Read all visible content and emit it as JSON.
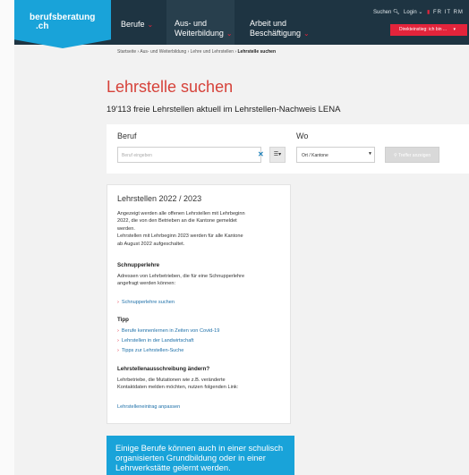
{
  "header": {
    "logo": {
      "line1": "berufsberatung",
      "line2": ".ch"
    },
    "nav": [
      {
        "line1": "Berufe",
        "line2": ""
      },
      {
        "line1": "Aus- und",
        "line2": "Weiterbildung"
      },
      {
        "line1": "Arbeit und",
        "line2": "Beschäftigung"
      }
    ],
    "utility": {
      "search": "Suchen",
      "login": "Login",
      "lang_fr": "FR",
      "lang_it": "IT",
      "lang_rm": "RM"
    },
    "cta": "Direkteinstieg: ich bin ..."
  },
  "breadcrumb": {
    "items": [
      "Startseite",
      "Aus- und Weiterbildung",
      "Lehre und Lehrstellen"
    ],
    "current": "Lehrstelle suchen",
    "separator": "›"
  },
  "page": {
    "title": "Lehrstelle suchen",
    "subtitle": "19'113 freie Lehrstellen aktuell im Lehrstellen-Nachweis LENA"
  },
  "search": {
    "beruf_label": "Beruf",
    "beruf_placeholder": "Beruf eingeben",
    "wo_label": "Wo",
    "ort_value": "Ort / Kantone",
    "results_button": "Treffer anzeigen"
  },
  "info": {
    "title": "Lehrstellen 2022 / 2023",
    "intro_lines": [
      "Angezeigt werden alle offenen Lehrstellen mit Lehrbeginn",
      "2022, die von den Betrieben an die Kantone gemeldet",
      "werden.",
      "Lehrstellen mit Lehrbeginn 2023 werden für alle Kantone",
      "ab August 2022 aufgeschaltet."
    ],
    "schnupper_heading": "Schnupperlehre",
    "schnupper_lines": [
      "Adressen von Lehrbetrieben, die für eine Schnupperlehre",
      "angefragt werden können:"
    ],
    "schnupper_link": "Schnupperlehre suchen",
    "tipp_heading": "Tipp",
    "tipp_links": [
      "Berufe kennenlernen in Zeiten von Covid-19",
      "Lehrstellen in der Landwirtschaft",
      "Tipps zur Lehrstellen-Suche"
    ],
    "aendern_heading": "Lehrstellenausschreibung ändern?",
    "aendern_lines": [
      "Lehrbetriebe, die Mutationen wie z.B. veränderte",
      "Kontaktdaten melden möchten, nutzen folgenden Link:"
    ],
    "aendern_link": "Lehrstelleneintrag anpassen"
  },
  "promo": {
    "lines": [
      "Einige Berufe können auch in einer schulisch",
      "organisierten Grundbildung oder in einer",
      "Lehrwerkstätte gelernt werden."
    ]
  },
  "colors": {
    "header_bg": "#1e3442",
    "logo_blue": "#19a3d9",
    "accent_red": "#e3243b",
    "title_red": "#d6423a",
    "link_blue": "#1c6fa8"
  }
}
